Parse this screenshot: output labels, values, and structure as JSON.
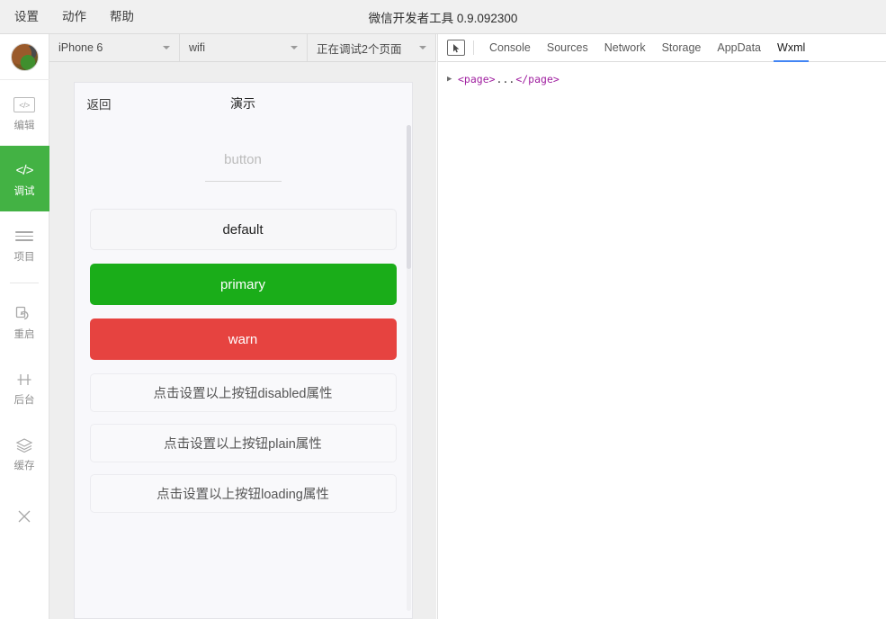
{
  "window": {
    "title": "微信开发者工具 0.9.092300",
    "menu": [
      {
        "label": "设置",
        "name": "menu-settings"
      },
      {
        "label": "动作",
        "name": "menu-actions"
      },
      {
        "label": "帮助",
        "name": "menu-help"
      }
    ]
  },
  "rail": {
    "avatar_alt": "user-avatar",
    "items": [
      {
        "label": "编辑",
        "icon": "code-box-icon",
        "active": false
      },
      {
        "label": "调试",
        "icon": "code-icon",
        "active": true
      },
      {
        "label": "项目",
        "icon": "list-lines-icon",
        "active": false
      },
      {
        "label": "重启",
        "icon": "restart-icon",
        "active": false
      },
      {
        "label": "后台",
        "icon": "background-icon",
        "active": false
      },
      {
        "label": "缓存",
        "icon": "layers-icon",
        "active": false
      },
      {
        "label": "",
        "icon": "close-icon",
        "active": false
      }
    ]
  },
  "simulator": {
    "toolbar": {
      "device": "iPhone 6",
      "network": "wifi",
      "pages": "正在调试2个页面"
    },
    "phone": {
      "back_label": "返回",
      "title": "演示",
      "section_heading": "button",
      "buttons": [
        {
          "label": "default",
          "style": "default"
        },
        {
          "label": "primary",
          "style": "primary"
        },
        {
          "label": "warn",
          "style": "warn"
        },
        {
          "label": "点击设置以上按钮disabled属性",
          "style": "mini"
        },
        {
          "label": "点击设置以上按钮plain属性",
          "style": "mini"
        },
        {
          "label": "点击设置以上按钮loading属性",
          "style": "mini"
        }
      ]
    }
  },
  "devtools": {
    "inspect_icon": "inspect-cursor-icon",
    "tabs": [
      {
        "label": "Console",
        "active": false
      },
      {
        "label": "Sources",
        "active": false
      },
      {
        "label": "Network",
        "active": false
      },
      {
        "label": "Storage",
        "active": false
      },
      {
        "label": "AppData",
        "active": false
      },
      {
        "label": "Wxml",
        "active": true
      }
    ],
    "tree": {
      "arrow": "▶",
      "open_tag": "<page>",
      "ellipsis": "...",
      "close_tag": "</page>"
    }
  },
  "colors": {
    "primary_green": "#1aad19",
    "warn_red": "#e64340",
    "rail_active_green": "#43b244",
    "tab_underline_blue": "#4285f4",
    "tag_purple": "#a020a0"
  }
}
